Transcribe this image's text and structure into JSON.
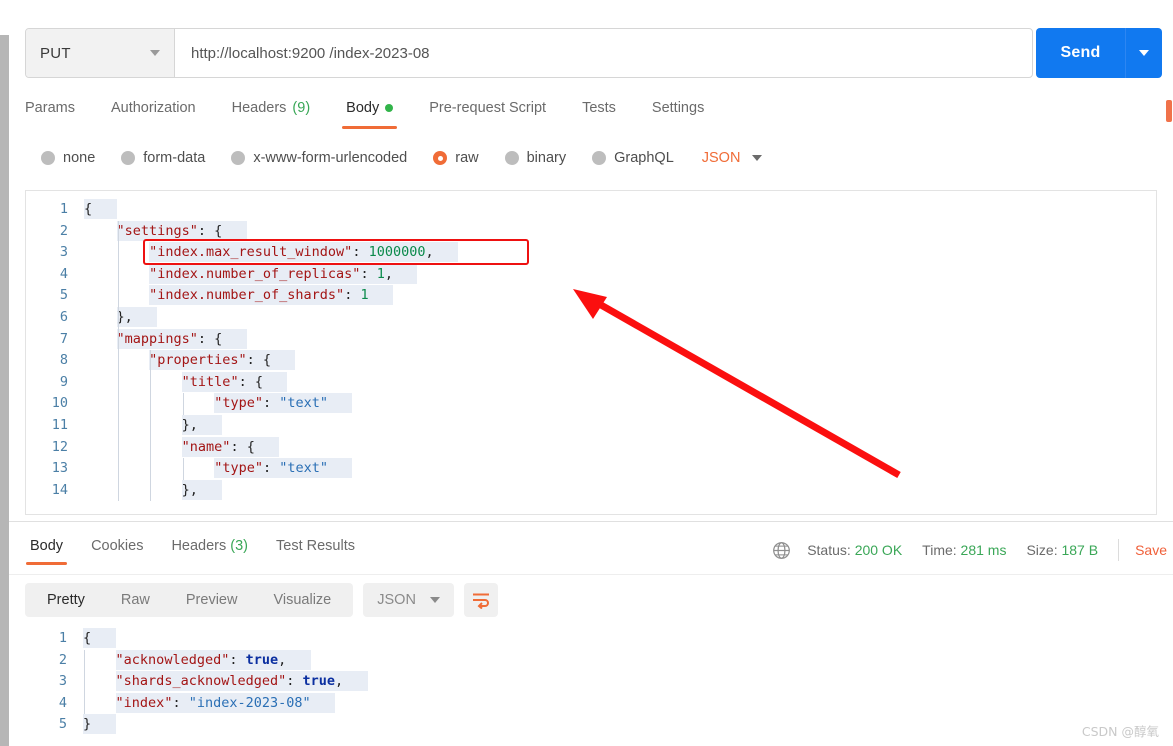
{
  "request": {
    "method": "PUT",
    "url": "http://localhost:9200 /index-2023-08",
    "send_label": "Send",
    "tabs": [
      {
        "label": "Params",
        "count": "",
        "dot": false,
        "active": false
      },
      {
        "label": "Authorization",
        "count": "",
        "dot": false,
        "active": false
      },
      {
        "label": "Headers",
        "count": "(9)",
        "dot": false,
        "active": false
      },
      {
        "label": "Body",
        "count": "",
        "dot": true,
        "active": true
      },
      {
        "label": "Pre-request Script",
        "count": "",
        "dot": false,
        "active": false
      },
      {
        "label": "Tests",
        "count": "",
        "dot": false,
        "active": false
      },
      {
        "label": "Settings",
        "count": "",
        "dot": false,
        "active": false
      }
    ],
    "body_types": [
      {
        "label": "none",
        "checked": false
      },
      {
        "label": "form-data",
        "checked": false
      },
      {
        "label": "x-www-form-urlencoded",
        "checked": false
      },
      {
        "label": "raw",
        "checked": true
      },
      {
        "label": "binary",
        "checked": false
      },
      {
        "label": "GraphQL",
        "checked": false
      }
    ],
    "body_format": "JSON",
    "body_lines": [
      {
        "n": "1",
        "indent": 0,
        "tokens": [
          {
            "t": "punc",
            "v": "{"
          }
        ]
      },
      {
        "n": "2",
        "indent": 1,
        "tokens": [
          {
            "t": "key",
            "v": "\"settings\""
          },
          {
            "t": "punc",
            "v": ": {"
          }
        ]
      },
      {
        "n": "3",
        "indent": 2,
        "tokens": [
          {
            "t": "key",
            "v": "\"index.max_result_window\""
          },
          {
            "t": "punc",
            "v": ": "
          },
          {
            "t": "num",
            "v": "1000000"
          },
          {
            "t": "punc",
            "v": ","
          }
        ]
      },
      {
        "n": "4",
        "indent": 2,
        "tokens": [
          {
            "t": "key",
            "v": "\"index.number_of_replicas\""
          },
          {
            "t": "punc",
            "v": ": "
          },
          {
            "t": "num",
            "v": "1"
          },
          {
            "t": "punc",
            "v": ","
          }
        ]
      },
      {
        "n": "5",
        "indent": 2,
        "tokens": [
          {
            "t": "key",
            "v": "\"index.number_of_shards\""
          },
          {
            "t": "punc",
            "v": ": "
          },
          {
            "t": "num",
            "v": "1"
          }
        ]
      },
      {
        "n": "6",
        "indent": 1,
        "tokens": [
          {
            "t": "punc",
            "v": "},"
          }
        ]
      },
      {
        "n": "7",
        "indent": 1,
        "tokens": [
          {
            "t": "key",
            "v": "\"mappings\""
          },
          {
            "t": "punc",
            "v": ": {"
          }
        ]
      },
      {
        "n": "8",
        "indent": 2,
        "tokens": [
          {
            "t": "key",
            "v": "\"properties\""
          },
          {
            "t": "punc",
            "v": ": {"
          }
        ]
      },
      {
        "n": "9",
        "indent": 3,
        "tokens": [
          {
            "t": "key",
            "v": "\"title\""
          },
          {
            "t": "punc",
            "v": ": {"
          }
        ]
      },
      {
        "n": "10",
        "indent": 4,
        "tokens": [
          {
            "t": "key",
            "v": "\"type\""
          },
          {
            "t": "punc",
            "v": ": "
          },
          {
            "t": "str",
            "v": "\"text\""
          }
        ]
      },
      {
        "n": "11",
        "indent": 3,
        "tokens": [
          {
            "t": "punc",
            "v": "},"
          }
        ]
      },
      {
        "n": "12",
        "indent": 3,
        "tokens": [
          {
            "t": "key",
            "v": "\"name\""
          },
          {
            "t": "punc",
            "v": ": {"
          }
        ]
      },
      {
        "n": "13",
        "indent": 4,
        "tokens": [
          {
            "t": "key",
            "v": "\"type\""
          },
          {
            "t": "punc",
            "v": ": "
          },
          {
            "t": "str",
            "v": "\"text\""
          }
        ]
      },
      {
        "n": "14",
        "indent": 3,
        "tokens": [
          {
            "t": "punc",
            "v": "},"
          }
        ]
      }
    ]
  },
  "annotation": {
    "highlight_color": "#ee1111",
    "arrow_color": "#fb0f0f",
    "highlighted_line": "\"index.max_result_window\": 1000000,"
  },
  "response": {
    "tabs": [
      {
        "label": "Body",
        "count": "",
        "active": true
      },
      {
        "label": "Cookies",
        "count": "",
        "active": false
      },
      {
        "label": "Headers",
        "count": "(3)",
        "active": false
      },
      {
        "label": "Test Results",
        "count": "",
        "active": false
      }
    ],
    "meta": {
      "status_label": "Status:",
      "status_value": "200 OK",
      "time_label": "Time:",
      "time_value": "281 ms",
      "size_label": "Size:",
      "size_value": "187 B",
      "save_label": "Save",
      "save_label_right": "Save"
    },
    "view_modes": [
      {
        "label": "Pretty",
        "active": true
      },
      {
        "label": "Raw",
        "active": false
      },
      {
        "label": "Preview",
        "active": false
      },
      {
        "label": "Visualize",
        "active": false
      }
    ],
    "format": "JSON",
    "body_lines": [
      {
        "n": "1",
        "indent": 0,
        "tokens": [
          {
            "t": "punc",
            "v": "{"
          }
        ]
      },
      {
        "n": "2",
        "indent": 1,
        "tokens": [
          {
            "t": "key",
            "v": "\"acknowledged\""
          },
          {
            "t": "punc",
            "v": ": "
          },
          {
            "t": "bool",
            "v": "true"
          },
          {
            "t": "punc",
            "v": ","
          }
        ]
      },
      {
        "n": "3",
        "indent": 1,
        "tokens": [
          {
            "t": "key",
            "v": "\"shards_acknowledged\""
          },
          {
            "t": "punc",
            "v": ": "
          },
          {
            "t": "bool",
            "v": "true"
          },
          {
            "t": "punc",
            "v": ","
          }
        ]
      },
      {
        "n": "4",
        "indent": 1,
        "tokens": [
          {
            "t": "key",
            "v": "\"index\""
          },
          {
            "t": "punc",
            "v": ": "
          },
          {
            "t": "str",
            "v": "\"index-2023-08\""
          }
        ]
      },
      {
        "n": "5",
        "indent": 0,
        "tokens": [
          {
            "t": "punc",
            "v": "}"
          }
        ]
      }
    ]
  },
  "watermark": "CSDN @醇氧",
  "colors": {
    "accent_orange": "#f06c37",
    "send_blue": "#1179f0",
    "status_green": "#3aa757"
  }
}
